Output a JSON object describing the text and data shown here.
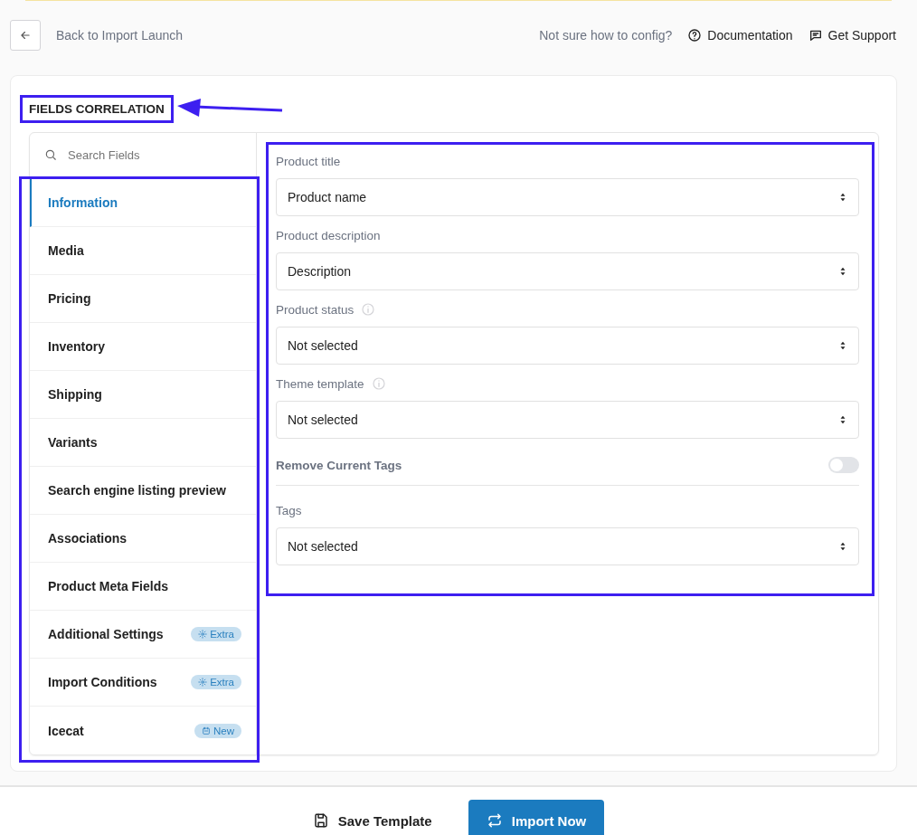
{
  "header": {
    "back_label": "Back to Import Launch",
    "help_text": "Not sure how to config?",
    "links": [
      {
        "kind": "docs",
        "label": "Documentation"
      },
      {
        "kind": "support",
        "label": "Get Support"
      }
    ]
  },
  "section_title": "FIELDS CORRELATION",
  "sidebar": {
    "search": {
      "placeholder": "Search Fields"
    },
    "items": [
      {
        "label": "Information",
        "selected": true
      },
      {
        "label": "Media",
        "selected": false
      },
      {
        "label": "Pricing",
        "selected": false
      },
      {
        "label": "Inventory",
        "selected": false
      },
      {
        "label": "Shipping",
        "selected": false
      },
      {
        "label": "Variants",
        "selected": false
      },
      {
        "label": "Search engine listing preview",
        "selected": false
      },
      {
        "label": "Associations",
        "selected": false
      },
      {
        "label": "Product Meta Fields",
        "selected": false
      },
      {
        "label": "Additional Settings",
        "selected": false,
        "badge": {
          "kind": "gear",
          "text": "Extra"
        }
      },
      {
        "label": "Import Conditions",
        "selected": false,
        "badge": {
          "kind": "gear",
          "text": "Extra"
        }
      },
      {
        "label": "Icecat",
        "selected": false,
        "badge": {
          "kind": "box",
          "text": "New"
        }
      }
    ]
  },
  "fields": [
    {
      "kind": "select",
      "label": "Product title",
      "info": false,
      "value": "Product name"
    },
    {
      "kind": "select",
      "label": "Product description",
      "info": false,
      "value": "Description"
    },
    {
      "kind": "select",
      "label": "Product status",
      "info": true,
      "value": "Not selected"
    },
    {
      "kind": "select",
      "label": "Theme template",
      "info": true,
      "value": "Not selected"
    },
    {
      "kind": "toggle",
      "label": "Remove Current Tags",
      "on": false
    },
    {
      "kind": "select",
      "label": "Tags",
      "info": false,
      "value": "Not selected"
    }
  ],
  "footer": {
    "buttons": [
      {
        "kind": "save",
        "label": "Save Template"
      },
      {
        "kind": "import",
        "label": "Import Now"
      }
    ]
  }
}
